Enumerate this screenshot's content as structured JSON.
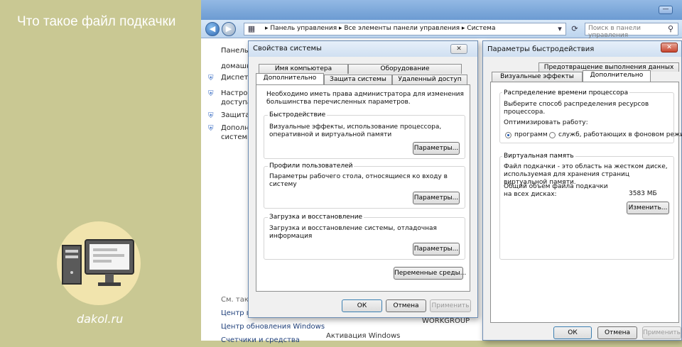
{
  "left_panel": {
    "title": "Что такое файл подкачки",
    "site": "dakol.ru"
  },
  "explorer": {
    "breadcrumb": "▸  Панель управления  ▸  Все элементы панели управления  ▸  Система",
    "search_placeholder": "Поиск в панели управления",
    "sidebar": [
      {
        "label": "Панель у",
        "icon": "none"
      },
      {
        "label": "домашня",
        "icon": "none"
      },
      {
        "label": "Диспетче",
        "icon": "shield-icon"
      },
      {
        "label": "Настройк",
        "icon": "shield-icon"
      },
      {
        "label": "доступа",
        "icon": "none"
      },
      {
        "label": "Защита с",
        "icon": "shield-icon"
      },
      {
        "label": "Дополни",
        "icon": "shield-icon"
      },
      {
        "label": "системы",
        "icon": "none"
      }
    ],
    "see_also": "См. также",
    "footer_links": [
      "Центр по",
      "Центр обновления Windows",
      "Счетчики и средства"
    ],
    "workgroup": "WORKGROUP",
    "activation": "Активация Windows"
  },
  "system_properties": {
    "title": "Свойства системы",
    "tabs_row1": [
      "Имя компьютера",
      "Оборудование"
    ],
    "tabs_row2": [
      "Дополнительно",
      "Защита системы",
      "Удаленный доступ"
    ],
    "admin_note": "Необходимо иметь права администратора для изменения большинства перечисленных параметров.",
    "performance": {
      "label": "Быстродействие",
      "desc": "Визуальные эффекты, использование процессора, оперативной и виртуальной памяти",
      "button": "Параметры..."
    },
    "profiles": {
      "label": "Профили пользователей",
      "desc": "Параметры рабочего стола, относящиеся ко входу в систему",
      "button": "Параметры..."
    },
    "startup": {
      "label": "Загрузка и восстановление",
      "desc": "Загрузка и восстановление системы, отладочная информация",
      "button": "Параметры..."
    },
    "env_button": "Переменные среды...",
    "ok": "ОК",
    "cancel": "Отмена",
    "apply": "Применить"
  },
  "performance_options": {
    "title": "Параметры быстродействия",
    "tab_top": "Предотвращение выполнения данных",
    "tabs": [
      "Визуальные эффекты",
      "Дополнительно"
    ],
    "cpu": {
      "label": "Распределение времени процессора",
      "desc": "Выберите способ распределения ресурсов процессора.",
      "optimize": "Оптимизировать работу:",
      "option_programs": "программ",
      "option_services": "служб, работающих в фоновом режиме"
    },
    "vm": {
      "label": "Виртуальная память",
      "desc": "Файл подкачки - это область на жестком диске, используемая для хранения страниц виртуальной памяти.",
      "total_label": "Общий объем файла подкачки на всех дисках:",
      "total_value": "3583 МБ",
      "button": "Изменить..."
    },
    "ok": "ОК",
    "cancel": "Отмена",
    "apply": "Применить"
  }
}
